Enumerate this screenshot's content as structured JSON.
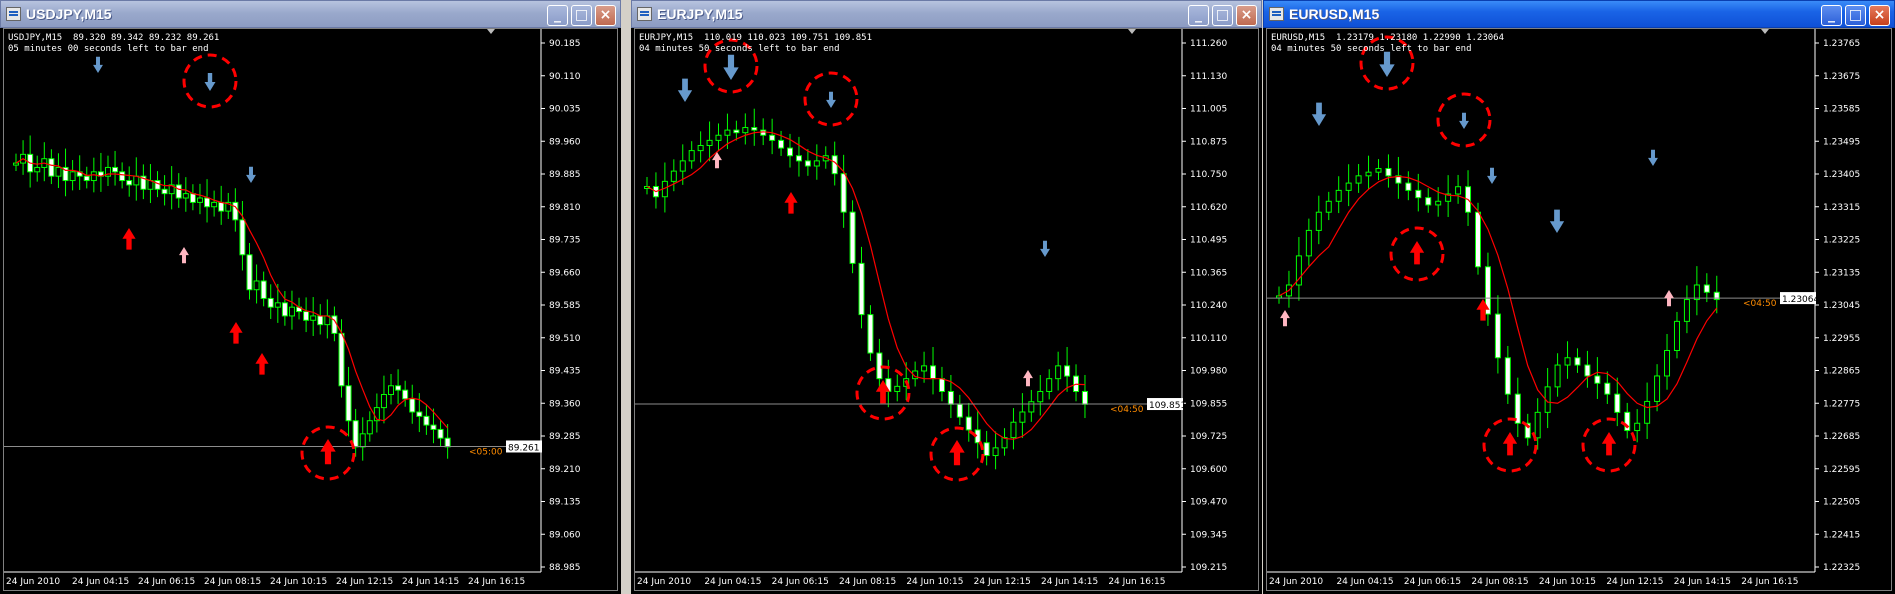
{
  "windows": [
    {
      "title": "USDJPY,M15",
      "active": false,
      "info_line1": "USDJPY,M15  89.320 89.342 89.232 89.261",
      "info_line2": "05 minutes 00 seconds left to bar end",
      "price_labels": [
        "90.185",
        "90.110",
        "90.035",
        "89.960",
        "89.885",
        "89.810",
        "89.735",
        "89.660",
        "89.585",
        "89.510",
        "89.435",
        "89.360",
        "89.285",
        "89.210",
        "89.135",
        "89.060",
        "88.985"
      ],
      "time_labels": [
        "24 Jun 2010",
        "24 Jun 04:15",
        "24 Jun 06:15",
        "24 Jun 08:15",
        "24 Jun 10:15",
        "24 Jun 12:15",
        "24 Jun 14:15",
        "24 Jun 16:15"
      ],
      "current_price": "89.261",
      "countdown": "<05:00",
      "chart_data": {
        "type": "candlestick",
        "ylim": [
          88.985,
          90.185
        ],
        "closes": [
          89.91,
          89.93,
          89.89,
          89.9,
          89.92,
          89.88,
          89.9,
          89.87,
          89.89,
          89.88,
          89.87,
          89.89,
          89.88,
          89.9,
          89.89,
          89.87,
          89.86,
          89.88,
          89.85,
          89.87,
          89.85,
          89.84,
          89.86,
          89.83,
          89.84,
          89.82,
          89.83,
          89.81,
          89.82,
          89.8,
          89.82,
          89.78,
          89.7,
          89.62,
          89.64,
          89.6,
          89.58,
          89.59,
          89.56,
          89.58,
          89.57,
          89.55,
          89.56,
          89.54,
          89.56,
          89.52,
          89.4,
          89.32,
          89.26,
          89.29,
          89.32,
          89.35,
          89.38,
          89.4,
          89.39,
          89.37,
          89.34,
          89.33,
          89.31,
          89.3,
          89.28,
          89.26
        ],
        "moving_average": "red"
      }
    },
    {
      "title": "EURJPY,M15",
      "active": false,
      "info_line1": "EURJPY,M15  110.019 110.023 109.751 109.851",
      "info_line2": "04 minutes 50 seconds left to bar end",
      "price_labels": [
        "111.260",
        "111.130",
        "111.005",
        "110.875",
        "110.750",
        "110.620",
        "110.495",
        "110.365",
        "110.240",
        "110.110",
        "109.980",
        "109.855",
        "109.725",
        "109.600",
        "109.470",
        "109.345",
        "109.215"
      ],
      "time_labels": [
        "24 Jun 2010",
        "24 Jun 04:15",
        "24 Jun 06:15",
        "24 Jun 08:15",
        "24 Jun 10:15",
        "24 Jun 12:15",
        "24 Jun 14:15",
        "24 Jun 16:15"
      ],
      "current_price": "109.851",
      "countdown": "<04:50",
      "chart_data": {
        "type": "candlestick",
        "ylim": [
          109.215,
          111.26
        ],
        "closes": [
          110.7,
          110.66,
          110.72,
          110.76,
          110.8,
          110.84,
          110.86,
          110.88,
          110.9,
          110.92,
          110.91,
          110.93,
          110.92,
          110.9,
          110.88,
          110.85,
          110.82,
          110.8,
          110.78,
          110.8,
          110.82,
          110.75,
          110.6,
          110.4,
          110.2,
          110.05,
          109.95,
          109.9,
          109.92,
          109.95,
          109.98,
          110.0,
          109.95,
          109.9,
          109.85,
          109.8,
          109.75,
          109.7,
          109.65,
          109.68,
          109.72,
          109.78,
          109.82,
          109.86,
          109.9,
          109.95,
          110.0,
          109.96,
          109.9,
          109.85
        ],
        "moving_average": "red"
      }
    },
    {
      "title": "EURUSD,M15",
      "active": true,
      "info_line1": "EURUSD,M15  1.23179 1.23180 1.22990 1.23064",
      "info_line2": "04 minutes 50 seconds left to bar end",
      "price_labels": [
        "1.23765",
        "1.23675",
        "1.23585",
        "1.23495",
        "1.23405",
        "1.23315",
        "1.23225",
        "1.23135",
        "1.23045",
        "1.22955",
        "1.22865",
        "1.22775",
        "1.22685",
        "1.22595",
        "1.22505",
        "1.22415",
        "1.22325"
      ],
      "time_labels": [
        "24 Jun 2010",
        "24 Jun 04:15",
        "24 Jun 06:15",
        "24 Jun 08:15",
        "24 Jun 10:15",
        "24 Jun 12:15",
        "24 Jun 14:15",
        "24 Jun 16:15"
      ],
      "current_price": "1.23064",
      "countdown": "<04:50",
      "chart_data": {
        "type": "candlestick",
        "ylim": [
          1.22325,
          1.23765
        ],
        "closes": [
          1.2307,
          1.231,
          1.2318,
          1.2325,
          1.233,
          1.2333,
          1.2336,
          1.2338,
          1.234,
          1.2341,
          1.2342,
          1.234,
          1.2338,
          1.2336,
          1.2334,
          1.2332,
          1.2333,
          1.2335,
          1.2337,
          1.233,
          1.2315,
          1.2302,
          1.229,
          1.228,
          1.2272,
          1.2268,
          1.2275,
          1.2282,
          1.2288,
          1.229,
          1.2288,
          1.2285,
          1.2283,
          1.228,
          1.2275,
          1.227,
          1.2272,
          1.2278,
          1.2285,
          1.2292,
          1.23,
          1.2306,
          1.231,
          1.2308,
          1.2306
        ],
        "moving_average": "red"
      }
    }
  ],
  "colors": {
    "bull_candle": "#00ff00",
    "body_fill": "#ffffff",
    "ma_line": "#ff0000",
    "arrow_up": "#ff0000",
    "arrow_up_small": "#ffb6c1",
    "arrow_down": "#6699cc",
    "circle": "#ff0000",
    "price_line": "#8c8c8c"
  },
  "icons": {
    "minimize": "minimize-icon",
    "maximize": "maximize-icon",
    "close": "close-icon",
    "window_icon": "chart-window-icon"
  }
}
